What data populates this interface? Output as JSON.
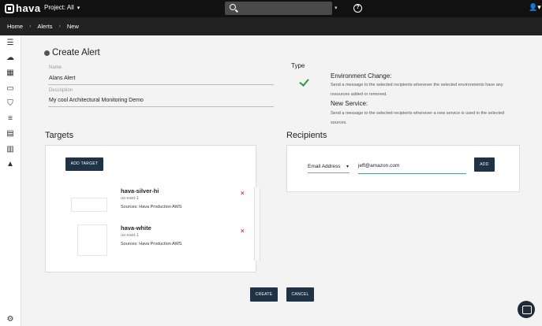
{
  "topbar": {
    "logo_text": "hava",
    "project_label": "Project: All",
    "search_placeholder": "",
    "help_glyph": "?",
    "user_glyph": "👤"
  },
  "breadcrumb": [
    "Home",
    "Alerts",
    "New"
  ],
  "sidebar": {
    "icons": [
      "menu-icon",
      "cloud-upload-icon",
      "grid-icon",
      "laptop-icon",
      "shield-icon",
      "list-icon",
      "table-icon",
      "bar-chart-icon",
      "warning-icon",
      "settings-icon"
    ]
  },
  "form": {
    "title": "Create Alert",
    "name_label": "Name",
    "name_value": "Alans Alert",
    "description_label": "Description",
    "description_value": "My cool Architectural Monitoring Demo"
  },
  "type": {
    "label": "Type",
    "options": [
      {
        "title": "Environment Change:",
        "desc": "Send a message to the selected recipients whenever the selected environments have any resources added or removed."
      },
      {
        "title": "New Service:",
        "desc": "Send a message to the selected recipients whenever a new service is used in the selected sources."
      }
    ]
  },
  "targets": {
    "heading": "Targets",
    "add_button": "ADD TARGET",
    "items": [
      {
        "name": "hava-silver-hi",
        "region": "us-east-1",
        "sources": "Sources: Hava Production AWS"
      },
      {
        "name": "hava-white",
        "region": "us-east-1",
        "sources": "Sources: Hava Production AWS"
      }
    ],
    "delete_glyph": "×"
  },
  "recipients": {
    "heading": "Recipients",
    "select_value": "Email Address",
    "email_value": "jeff@amazon.com",
    "add_button": "ADD"
  },
  "actions": {
    "create": "CREATE",
    "cancel": "CANCEL"
  },
  "colors": {
    "topbar": "#111111",
    "crumbbar": "#222222",
    "button_dark": "#1f3346",
    "check_green": "#2d9c3c",
    "delete_red": "#dd3333",
    "input_accent": "#33aaaa"
  }
}
